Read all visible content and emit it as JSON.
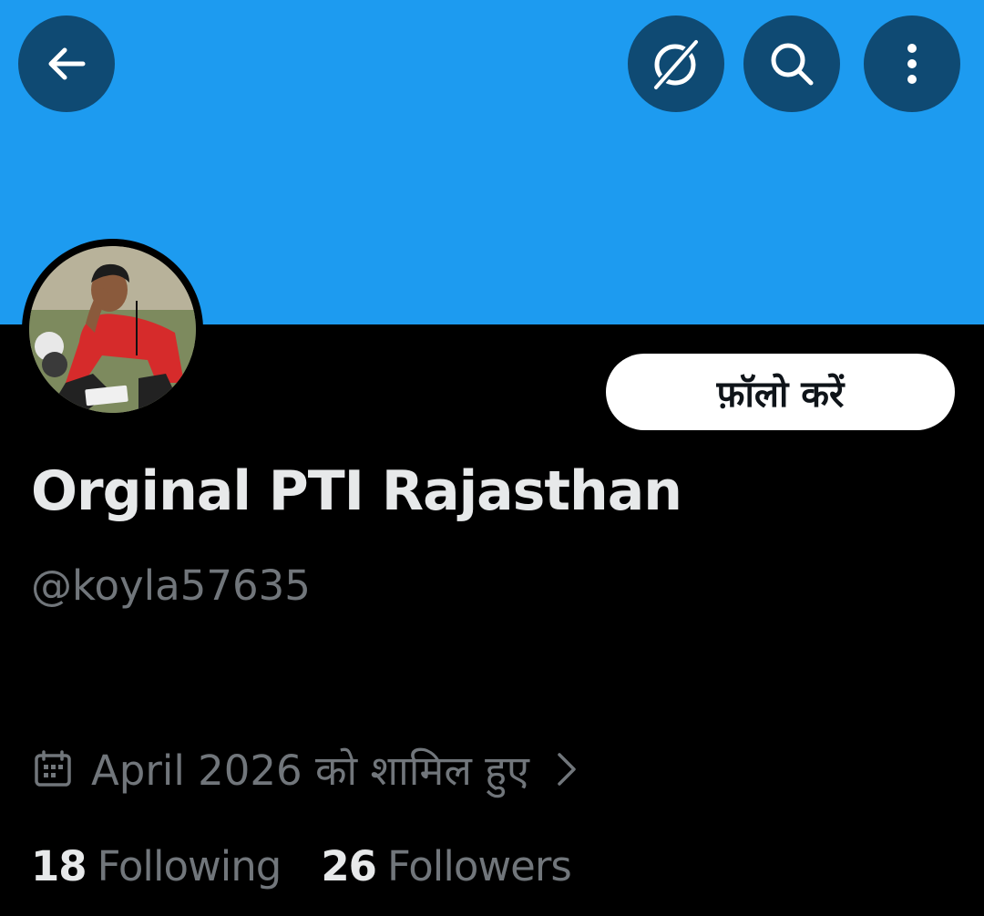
{
  "header": {
    "back_icon": "arrow-left-icon",
    "grok_icon": "grok-icon",
    "search_icon": "search-icon",
    "more_icon": "vertical-ellipsis-icon"
  },
  "colors": {
    "banner": "#1d9bf0",
    "header_button_bg": "#0f4a73",
    "background": "#000000",
    "primary_text": "#e7e9ea",
    "secondary_text": "#71767b"
  },
  "profile": {
    "follow_label": "फ़ॉलो करें",
    "display_name": "Orginal PTI Rajasthan",
    "handle": "@koyla57635",
    "joined_text": "April 2026 को शामिल हुए",
    "following_count": "18",
    "following_label": "Following",
    "followers_count": "26",
    "followers_label": "Followers"
  }
}
